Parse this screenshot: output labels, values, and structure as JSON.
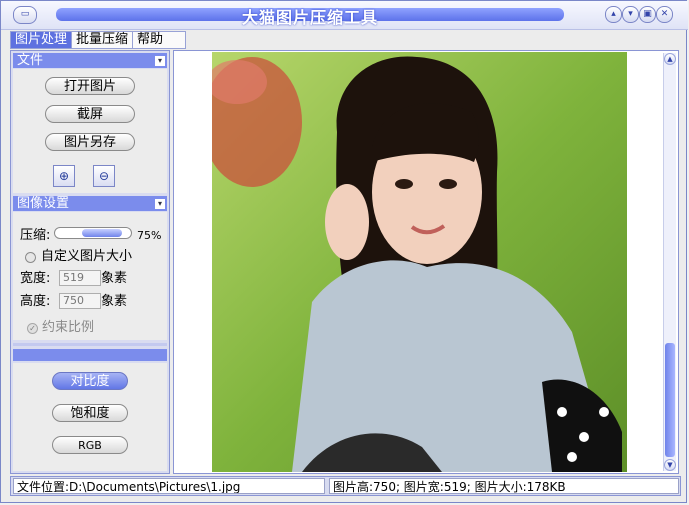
{
  "window": {
    "title": "大猫图片压缩工具",
    "accent_color": "#5e71e0",
    "buttons": [
      "minimize-icon",
      "chevron-down-icon",
      "restore-icon",
      "close-icon"
    ]
  },
  "menu": {
    "items": [
      "图片处理",
      "批量压缩",
      "帮助"
    ],
    "active_index": 0
  },
  "file_section": {
    "header": "文件",
    "open_label": "打开图片",
    "screenshot_label": "截屏",
    "save_as_label": "图片另存",
    "zoom_in_icon": "zoom-in-icon",
    "zoom_out_icon": "zoom-out-icon"
  },
  "image_settings": {
    "header": "图像设置",
    "compress_label": "压缩:",
    "compress_value": "75%",
    "compress_fraction": 0.75,
    "custom_size_label": "自定义图片大小",
    "width_label": "宽度:",
    "width_value": "519",
    "width_unit": "象素",
    "height_label": "高度:",
    "height_value": "750",
    "height_unit": "象素",
    "keep_ratio_label": "约束比例"
  },
  "adjust_section": {
    "contrast_label": "对比度",
    "saturation_label": "饱和度",
    "rgb_label": "RGB"
  },
  "status": {
    "path": "文件位置:D:\\Documents\\Pictures\\1.jpg",
    "info": "图片高:750; 图片宽:519; 图片大小:178KB"
  }
}
